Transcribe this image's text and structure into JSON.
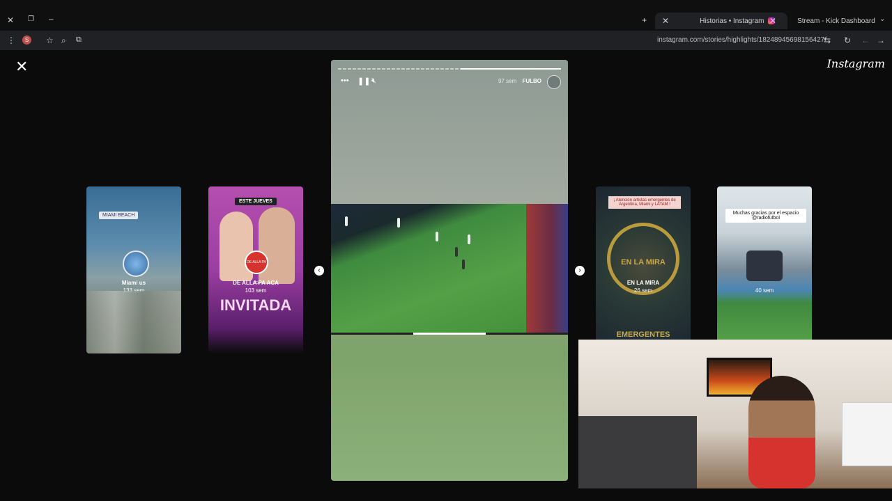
{
  "browser": {
    "tabs": [
      {
        "title": "Stream - Kick Dashboard",
        "active": false
      },
      {
        "title": "Historias • Instagram",
        "active": true
      }
    ],
    "url": "instagram.com/stories/highlights/18248945698156427/"
  },
  "instagram": {
    "logo": "Instagram",
    "main_story": {
      "username": "FULBO",
      "time": "97 sem",
      "progress": 0.45
    },
    "left_cards": [
      {
        "title": "Miami us",
        "time": "133 sem",
        "tag": "MIAMI BEACH"
      },
      {
        "title": "DE ALLA PA ACA",
        "time": "103 sem",
        "header": "ESTE JUEVES",
        "sub": "INVITADA",
        "badge": "DE ALLA PA ACA"
      }
    ],
    "right_cards": [
      {
        "title": "EN LA MIRA",
        "time": "26 sem",
        "top_text": "¡ Atención artistas emergentes de Argentina, Miami y LATAM !",
        "big_text": "EN LA MIRA EMERGENTES"
      },
      {
        "title": "40 sem",
        "top_text": "Muchas gracias por el espacio @radiofutbol"
      }
    ]
  },
  "colors": {
    "story_bg": "#0b0b0b",
    "chrome": "#202124",
    "accent_red": "#d6332f"
  }
}
